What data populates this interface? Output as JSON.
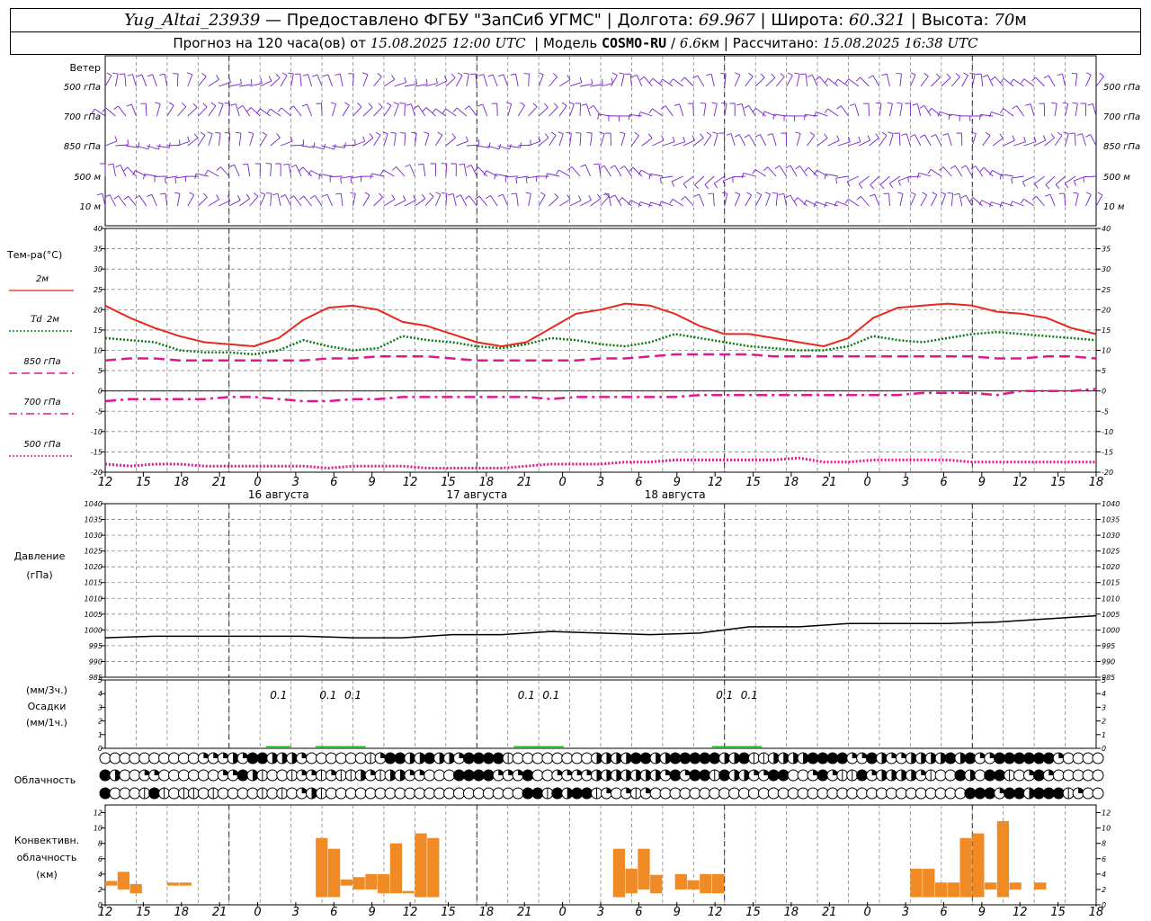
{
  "header": {
    "station": "Yug_Altai_23939",
    "dash": "—",
    "provider": "Предоставлено ФГБУ \"ЗапСиб УГМС\"",
    "lon_label": "Долгота:",
    "lon": "69.967",
    "lat_label": "Широта:",
    "lat": "60.321",
    "alt_label": "Высота:",
    "alt": "70",
    "alt_unit": "м",
    "sep": "|",
    "forecast_prefix": "Прогноз на 120 часа(ов) от",
    "forecast_time": "15.08.2025 12:00 UTC",
    "model_label": "Модель",
    "model": "COSMO-RU",
    "model_res_sep": "/",
    "model_res": "6.6",
    "model_res_unit": "км",
    "calc_label": "Рассчитано:",
    "calc_time": "15.08.2025 16:38 UTC"
  },
  "colors": {
    "grid": "#888888",
    "wind": "#7722cc",
    "t2m": "#e8281e",
    "td": "#0a7a14",
    "t850": "#e0188c",
    "t700": "#e0188c",
    "t500": "#e0188c",
    "pressure": "#000000",
    "precip": "#22bb22",
    "convective": "#f08a24"
  },
  "hour_ticks": [
    "12",
    "15",
    "18",
    "21",
    "0",
    "3",
    "6",
    "9",
    "12",
    "15",
    "18",
    "21",
    "0",
    "3",
    "6",
    "9",
    "12",
    "15",
    "18",
    "21",
    "0",
    "3",
    "6",
    "9",
    "12",
    "15",
    "18"
  ],
  "day_labels": [
    {
      "label": "16 августа",
      "hour": 21
    },
    {
      "label": "17 августа",
      "hour": 45
    },
    {
      "label": "18 августа",
      "hour": 69
    }
  ],
  "wind_panel": {
    "title": "Ветер",
    "levels": [
      "500 гПа",
      "700 гПа",
      "850 гПа",
      "500 м",
      "10 м"
    ]
  },
  "temp_panel": {
    "title": "Тем-ра(°C)",
    "ylim": [
      -20,
      40
    ],
    "ticks": [
      "40",
      "35",
      "30",
      "25",
      "20",
      "15",
      "10",
      "5",
      "0",
      "-5",
      "-10",
      "-15",
      "-20"
    ],
    "legend": [
      {
        "label": "2м",
        "style": "solid"
      },
      {
        "label_it": "Td",
        "label": "2м",
        "style": "dot"
      },
      {
        "label": "850 гПа",
        "style": "dash"
      },
      {
        "label": "700 гПа",
        "style": "dashdot"
      },
      {
        "label": "500 гПа",
        "style": "dot"
      }
    ]
  },
  "pressure_panel": {
    "title_line1": "Давление",
    "title_line2": "(гПа)",
    "ylim": [
      985,
      1040
    ],
    "ticks": [
      "1040",
      "1035",
      "1030",
      "1025",
      "1020",
      "1015",
      "1010",
      "1005",
      "1000",
      "995",
      "990",
      "985"
    ]
  },
  "precip_panel": {
    "unit_top": "(мм/3ч.)",
    "title": "Осадки",
    "unit_bottom": "(мм/1ч.)",
    "ticks": [
      "5",
      "4",
      "3",
      "2",
      "1",
      "0"
    ],
    "labels": [
      {
        "hour": 21,
        "text": "0.1"
      },
      {
        "hour": 27,
        "text": "0.1"
      },
      {
        "hour": 30,
        "text": "0.1"
      },
      {
        "hour": 51,
        "text": "0.1"
      },
      {
        "hour": 54,
        "text": "0.1"
      },
      {
        "hour": 75,
        "text": "0.1"
      },
      {
        "hour": 78,
        "text": "0.1"
      }
    ]
  },
  "cloud_panel": {
    "title": "Облачность",
    "rows": [
      "000000000022232443332000000124433433244441000000003333443344444334113333444422432233334342244444420000",
      "430022000000224310012212113213322000444422240022223333333242441433224400242114233332100430441024200000",
      "400014101101000010102310000000000000000000044143441202120000000000000000000000000000000044424434441200"
    ]
  },
  "conv_panel": {
    "title_line1": "Конвективн.",
    "title_line2": "облачность",
    "title_line3": "(км)",
    "ticks": [
      "12",
      "10",
      "8",
      "6",
      "4",
      "2",
      "0"
    ],
    "ylim": [
      0,
      13
    ]
  },
  "chart_data": [
    {
      "type": "line",
      "title": "Тем-ра(°C)",
      "x_hours_from_start": [
        0,
        3,
        6,
        9,
        12,
        15,
        18,
        21,
        24,
        27,
        30,
        33,
        36,
        39,
        42,
        45,
        48,
        51,
        54,
        57,
        60,
        63,
        66,
        69,
        72,
        75,
        78,
        81,
        84,
        87,
        90,
        93,
        96,
        99,
        102,
        105,
        108,
        111,
        114,
        117,
        120
      ],
      "ylim": [
        -20,
        40
      ],
      "series": [
        {
          "name": "2м",
          "values": [
            21,
            18,
            15.5,
            13.5,
            12,
            11.5,
            11,
            13,
            17.5,
            20.5,
            21,
            20,
            17,
            16,
            14,
            12,
            11,
            12,
            15.5,
            19,
            20,
            21.5,
            21,
            19,
            16,
            14,
            14,
            13,
            12,
            11,
            13,
            18,
            20.5,
            21,
            21.5,
            21,
            19.5,
            19,
            18,
            15.5,
            14
          ]
        },
        {
          "name": "Td 2м",
          "values": [
            13,
            12.5,
            12,
            10,
            9.5,
            9.5,
            9,
            10,
            12.5,
            11,
            10,
            10.5,
            13.5,
            12.5,
            12,
            11,
            10.5,
            11.5,
            13,
            12.5,
            11.5,
            11,
            12,
            14,
            13,
            12,
            11,
            10.5,
            10,
            10,
            11,
            13.5,
            12.5,
            12,
            13,
            14,
            14.5,
            14,
            13.5,
            13,
            12.5
          ]
        },
        {
          "name": "850 гПа",
          "values": [
            7.5,
            8,
            8,
            7.5,
            7.5,
            7.5,
            7.5,
            7.5,
            7.5,
            8,
            8,
            8.5,
            8.5,
            8.5,
            8,
            7.5,
            7.5,
            7.5,
            7.5,
            7.5,
            8,
            8,
            8.5,
            9,
            9,
            9,
            9,
            8.5,
            8.5,
            8.5,
            8.5,
            8.5,
            8.5,
            8.5,
            8.5,
            8.5,
            8,
            8,
            8.5,
            8.5,
            8
          ]
        },
        {
          "name": "700 гПа",
          "values": [
            -2.5,
            -2,
            -2,
            -2,
            -2,
            -1.5,
            -1.5,
            -2,
            -2.5,
            -2.5,
            -2,
            -2,
            -1.5,
            -1.5,
            -1.5,
            -1.5,
            -1.5,
            -1.5,
            -2,
            -1.5,
            -1.5,
            -1.5,
            -1.5,
            -1.5,
            -1,
            -1,
            -1,
            -1,
            -1,
            -1,
            -1,
            -1,
            -1,
            -0.5,
            -0.5,
            -0.5,
            -1,
            0,
            0,
            0,
            0.5
          ]
        },
        {
          "name": "500 гПа",
          "values": [
            -18,
            -18.5,
            -18,
            -18,
            -18.5,
            -18.5,
            -18.5,
            -18.5,
            -18.5,
            -19,
            -18.5,
            -18.5,
            -18.5,
            -19,
            -19,
            -19,
            -19,
            -18.5,
            -18,
            -18,
            -18,
            -17.5,
            -17.5,
            -17,
            -17,
            -17,
            -17,
            -17,
            -16.5,
            -17.5,
            -17.5,
            -17,
            -17,
            -17,
            -17,
            -17.5,
            -17.5,
            -17.5,
            -17.5,
            -17.5,
            -17.5
          ]
        }
      ]
    },
    {
      "type": "line",
      "title": "Давление (гПа)",
      "x_hours_from_start": [
        0,
        6,
        12,
        18,
        24,
        30,
        36,
        42,
        48,
        54,
        60,
        66,
        72,
        78,
        84,
        90,
        96,
        102,
        108,
        114,
        120
      ],
      "ylim": [
        985,
        1040
      ],
      "series": [
        {
          "name": "",
          "values": [
            997.5,
            998,
            998,
            998,
            998,
            997.5,
            997.5,
            998.5,
            998.5,
            999.5,
            999,
            998.5,
            999,
            1001,
            1001,
            1002,
            1002,
            1002,
            1002.5,
            1003.5,
            1004.5
          ]
        }
      ]
    },
    {
      "type": "bar",
      "title": "Осадки",
      "x_hours_from_start": [
        21,
        27,
        30,
        51,
        54,
        75,
        78
      ],
      "values": [
        0.1,
        0.1,
        0.1,
        0.1,
        0.1,
        0.1,
        0.1
      ]
    },
    {
      "type": "bar",
      "title": "Конвективн. облачность (км)",
      "ylim": [
        0,
        13
      ],
      "bars": [
        {
          "h": 0,
          "bottom": 2.5,
          "top": 3.1
        },
        {
          "h": 1,
          "bottom": 2,
          "top": 4.3
        },
        {
          "h": 2,
          "bottom": 1.5,
          "top": 2.7
        },
        {
          "h": 5,
          "bottom": 2.5,
          "top": 2.9
        },
        {
          "h": 6,
          "bottom": 2.5,
          "top": 2.9
        },
        {
          "h": 17,
          "bottom": 1,
          "top": 8.7
        },
        {
          "h": 18,
          "bottom": 1,
          "top": 7.3
        },
        {
          "h": 19,
          "bottom": 2.5,
          "top": 3.3
        },
        {
          "h": 20,
          "bottom": 2,
          "top": 3.6
        },
        {
          "h": 21,
          "bottom": 2,
          "top": 4
        },
        {
          "h": 22,
          "bottom": 1.5,
          "top": 4
        },
        {
          "h": 23,
          "bottom": 1.5,
          "top": 8
        },
        {
          "h": 24,
          "bottom": 1.5,
          "top": 1.8
        },
        {
          "h": 25,
          "bottom": 1,
          "top": 9.3
        },
        {
          "h": 26,
          "bottom": 1,
          "top": 8.7
        },
        {
          "h": 41,
          "bottom": 1,
          "top": 7.3
        },
        {
          "h": 42,
          "bottom": 1.5,
          "top": 4.7
        },
        {
          "h": 43,
          "bottom": 2,
          "top": 7.3
        },
        {
          "h": 44,
          "bottom": 1.5,
          "top": 3.9
        },
        {
          "h": 46,
          "bottom": 2,
          "top": 4
        },
        {
          "h": 47,
          "bottom": 2,
          "top": 3.2
        },
        {
          "h": 48,
          "bottom": 1.5,
          "top": 4
        },
        {
          "h": 49,
          "bottom": 1.5,
          "top": 4
        },
        {
          "h": 65,
          "bottom": 1,
          "top": 4.7
        },
        {
          "h": 66,
          "bottom": 1,
          "top": 4.7
        },
        {
          "h": 67,
          "bottom": 1,
          "top": 2.9
        },
        {
          "h": 68,
          "bottom": 1,
          "top": 2.9
        },
        {
          "h": 69,
          "bottom": 1,
          "top": 8.7
        },
        {
          "h": 70,
          "bottom": 1,
          "top": 9.3
        },
        {
          "h": 71,
          "bottom": 2,
          "top": 2.9
        },
        {
          "h": 72,
          "bottom": 1,
          "top": 10.9
        },
        {
          "h": 73,
          "bottom": 2,
          "top": 2.9
        },
        {
          "h": 75,
          "bottom": 2,
          "top": 2.9
        }
      ]
    }
  ]
}
